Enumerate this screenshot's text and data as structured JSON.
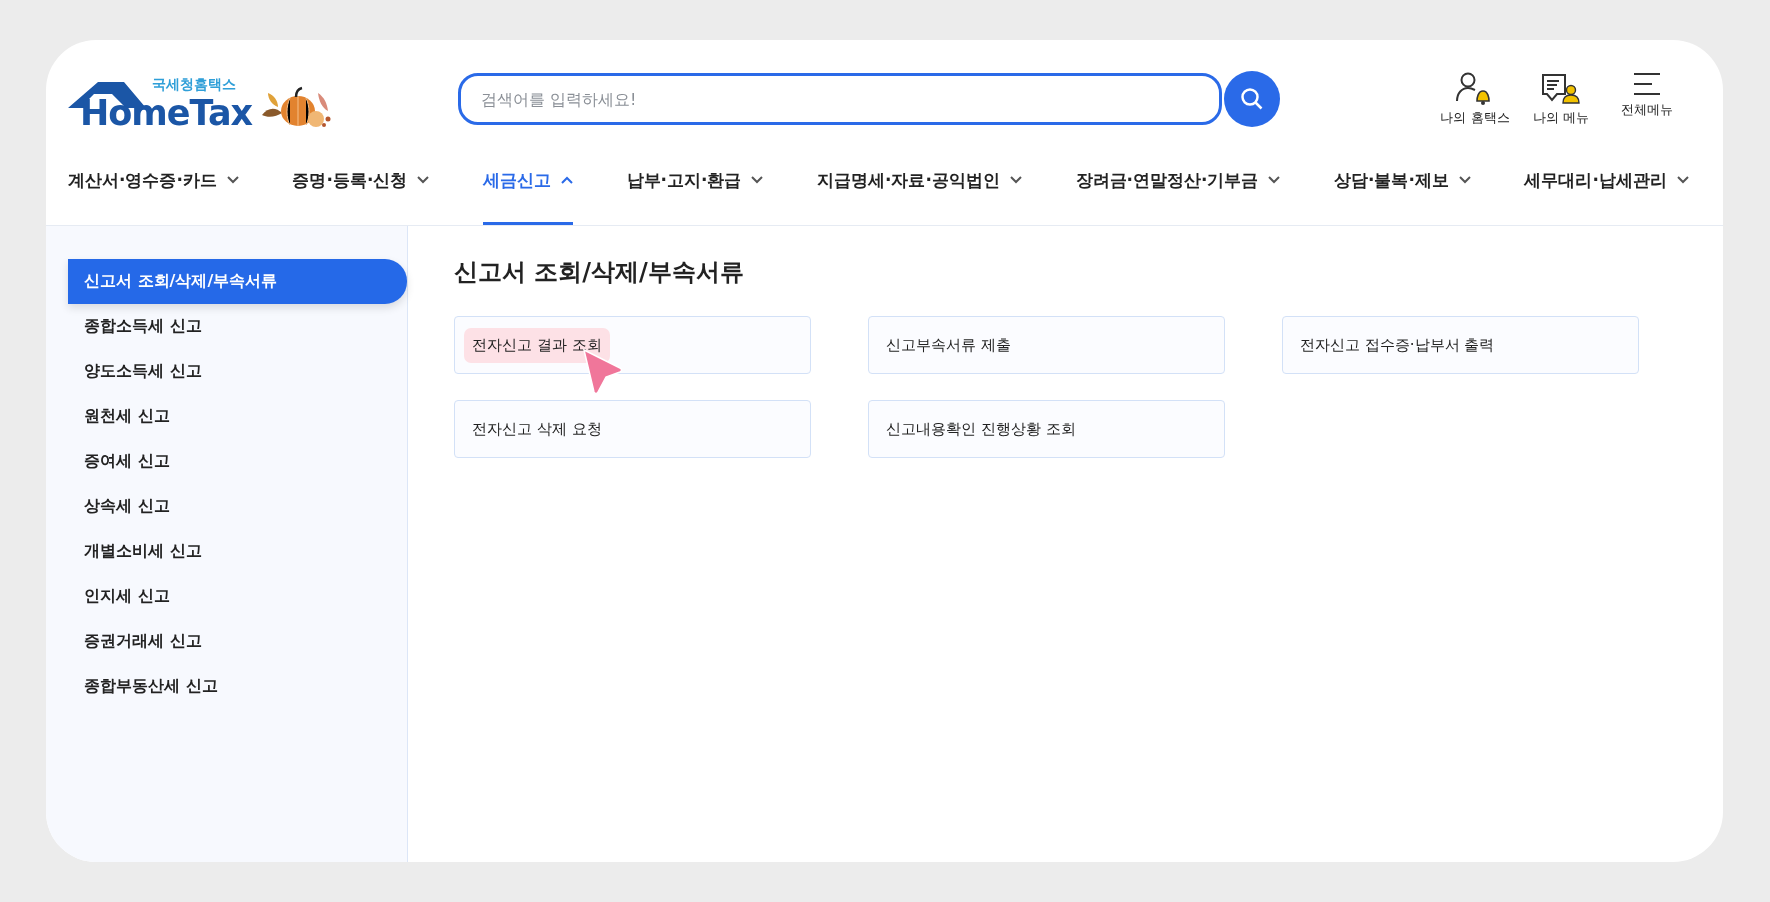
{
  "logo": {
    "subtitle": "국세청홈택스",
    "name": "HomeTax"
  },
  "search": {
    "placeholder": "검색어를 입력하세요!"
  },
  "header_links": [
    {
      "label": "나의 홈택스",
      "kind": "user-bell"
    },
    {
      "label": "나의 메뉴",
      "kind": "doc-user"
    },
    {
      "label": "전체메뉴",
      "kind": "menu"
    }
  ],
  "nav": [
    {
      "label": "계산서·영수증·카드",
      "selected": false,
      "expanded": false
    },
    {
      "label": "증명·등록·신청",
      "selected": false,
      "expanded": false
    },
    {
      "label": "세금신고",
      "selected": true,
      "expanded": true
    },
    {
      "label": "납부·고지·환급",
      "selected": false,
      "expanded": false
    },
    {
      "label": "지급명세·자료·공익법인",
      "selected": false,
      "expanded": false
    },
    {
      "label": "장려금·연말정산·기부금",
      "selected": false,
      "expanded": false
    },
    {
      "label": "상담·불복·제보",
      "selected": false,
      "expanded": false
    },
    {
      "label": "세무대리·납세관리",
      "selected": false,
      "expanded": false
    }
  ],
  "sidebar": {
    "items": [
      {
        "label": "신고서 조회/삭제/부속서류",
        "selected": true
      },
      {
        "label": "종합소득세 신고",
        "selected": false
      },
      {
        "label": "양도소득세 신고",
        "selected": false
      },
      {
        "label": "원천세 신고",
        "selected": false
      },
      {
        "label": "증여세 신고",
        "selected": false
      },
      {
        "label": "상속세 신고",
        "selected": false
      },
      {
        "label": "개별소비세 신고",
        "selected": false
      },
      {
        "label": "인지세 신고",
        "selected": false
      },
      {
        "label": "증권거래세 신고",
        "selected": false
      },
      {
        "label": "종합부동산세 신고",
        "selected": false
      }
    ]
  },
  "content": {
    "title": "신고서 조회/삭제/부속서류",
    "links": [
      {
        "label": "전자신고 결과 조회",
        "highlighted": true
      },
      {
        "label": "신고부속서류 제출",
        "highlighted": false
      },
      {
        "label": "전자신고 접수증·납부서 출력",
        "highlighted": false
      },
      {
        "label": "전자신고 삭제 요청",
        "highlighted": false
      },
      {
        "label": "신고내용확인 진행상황 조회",
        "highlighted": false
      }
    ]
  }
}
